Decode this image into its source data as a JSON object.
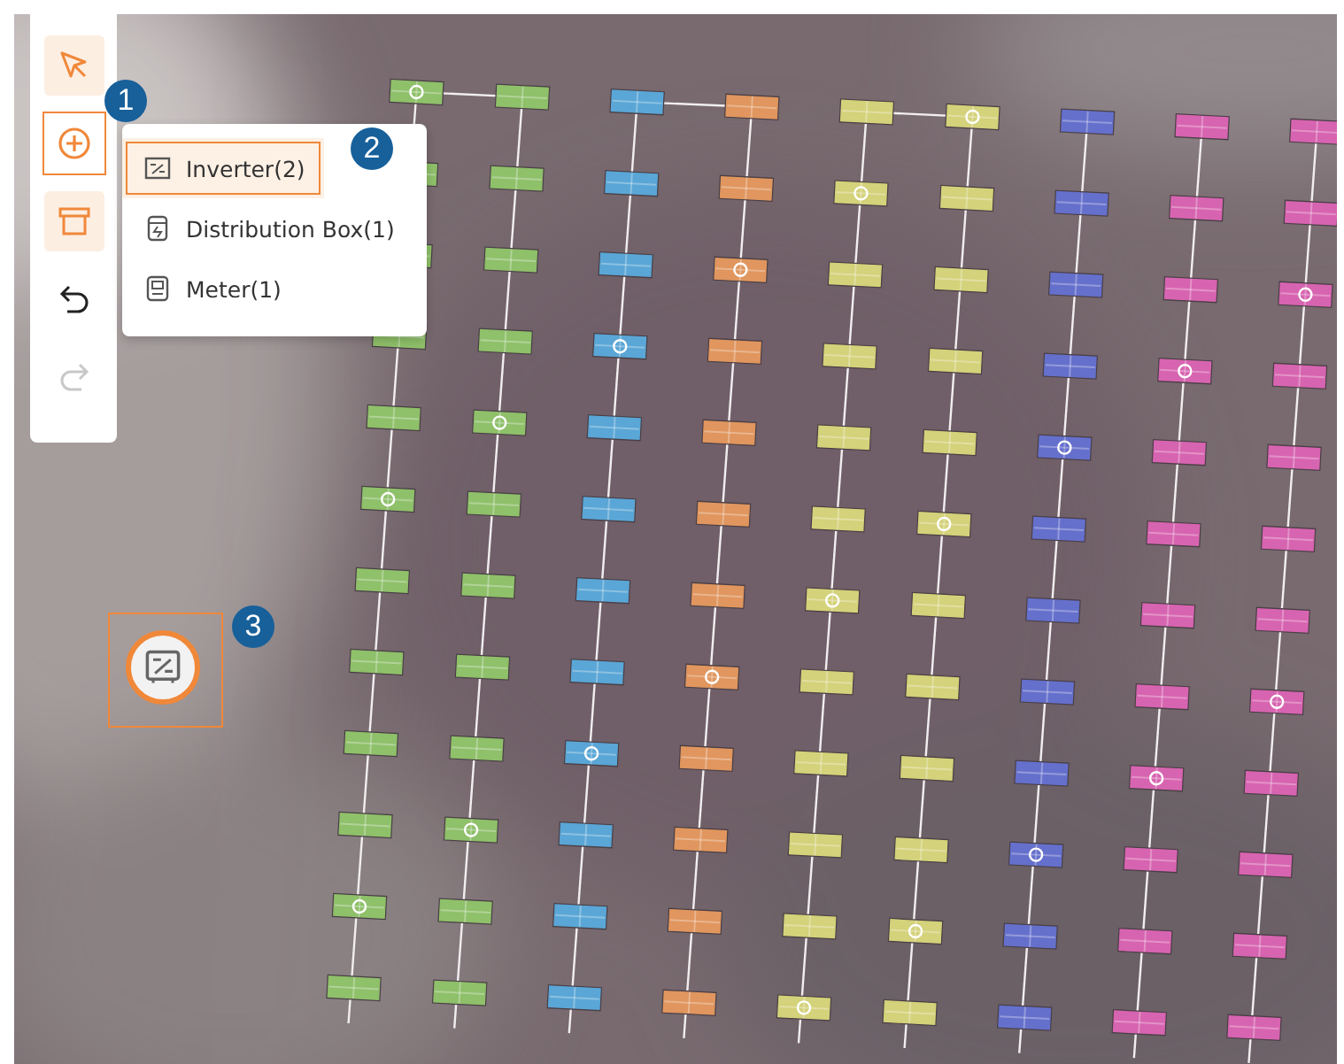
{
  "toolbar": {
    "tools": [
      {
        "kind": "select",
        "selected": true,
        "disabled": false,
        "highlighted": false
      },
      {
        "kind": "add",
        "selected": false,
        "disabled": false,
        "highlighted": true
      },
      {
        "kind": "area",
        "selected": true,
        "disabled": false,
        "highlighted": false
      },
      {
        "kind": "undo",
        "selected": false,
        "disabled": false,
        "highlighted": false
      },
      {
        "kind": "redo",
        "selected": false,
        "disabled": true,
        "highlighted": false
      }
    ]
  },
  "add_menu": {
    "items": [
      {
        "kind": "inverter",
        "label": "Inverter(2)",
        "selected": true
      },
      {
        "kind": "distribution_box",
        "label": "Distribution Box(1)",
        "selected": false
      },
      {
        "kind": "meter",
        "label": "Meter(1)",
        "selected": false
      }
    ]
  },
  "map": {
    "strings": [
      {
        "color": "#8fc06a"
      },
      {
        "color": "#8fc06a"
      },
      {
        "color": "#5aa6d6"
      },
      {
        "color": "#e0965e"
      },
      {
        "color": "#d4d27a"
      },
      {
        "color": "#d4d27a"
      },
      {
        "color": "#6570cc"
      },
      {
        "color": "#d764b0"
      },
      {
        "color": "#d764b0"
      }
    ],
    "marker": {
      "kind": "inverter"
    }
  },
  "callouts": [
    {
      "label": "1"
    },
    {
      "label": "2"
    },
    {
      "label": "3"
    }
  ]
}
